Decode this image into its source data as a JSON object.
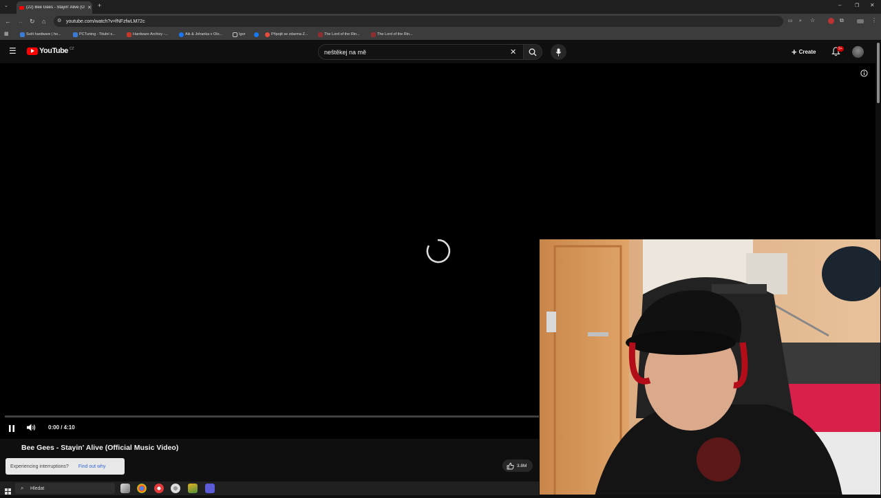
{
  "browser": {
    "tab_title": "(22) Bee Gees - Stayin' Alive (O",
    "new_tab_glyph": "+",
    "url": "youtube.com/watch?v=fNFzfwLM72c",
    "bookmarks": [
      {
        "label": "Svět hardware | ho...",
        "color": "#3a7bd5"
      },
      {
        "label": "PCTuning - Titulní s...",
        "color": "#3a7bd5"
      },
      {
        "label": "Hardware Archivy -...",
        "color": "#c0392b"
      },
      {
        "label": "Aik & Johanka v Olo...",
        "color": "#1877f2"
      },
      {
        "label": "Igor",
        "color": "#c8c8c8"
      },
      {
        "label": "Připojit se zdarma Z...",
        "color": "#e74c3c"
      },
      {
        "label": "The Lord of the Rin...",
        "color": "#8e2f2f"
      },
      {
        "label": "The Lord of the Rin...",
        "color": "#8e2f2f"
      }
    ]
  },
  "youtube": {
    "logo_text": "YouTube",
    "logo_sup": "CZ",
    "search_value": "neštěkej na mě",
    "create_label": "Create",
    "notification_count": "9+",
    "brand_color": "#ff0000"
  },
  "player": {
    "time": "0:00 / 4:10",
    "progress_fraction": 0.0,
    "state": "buffering"
  },
  "video": {
    "title": "Bee Gees - Stayin' Alive (Official Music Video)",
    "likes": "3.8M",
    "notice_text": "Experiencing interruptions?",
    "notice_link": "Find out why"
  },
  "taskbar": {
    "search_placeholder": "Hledat"
  }
}
